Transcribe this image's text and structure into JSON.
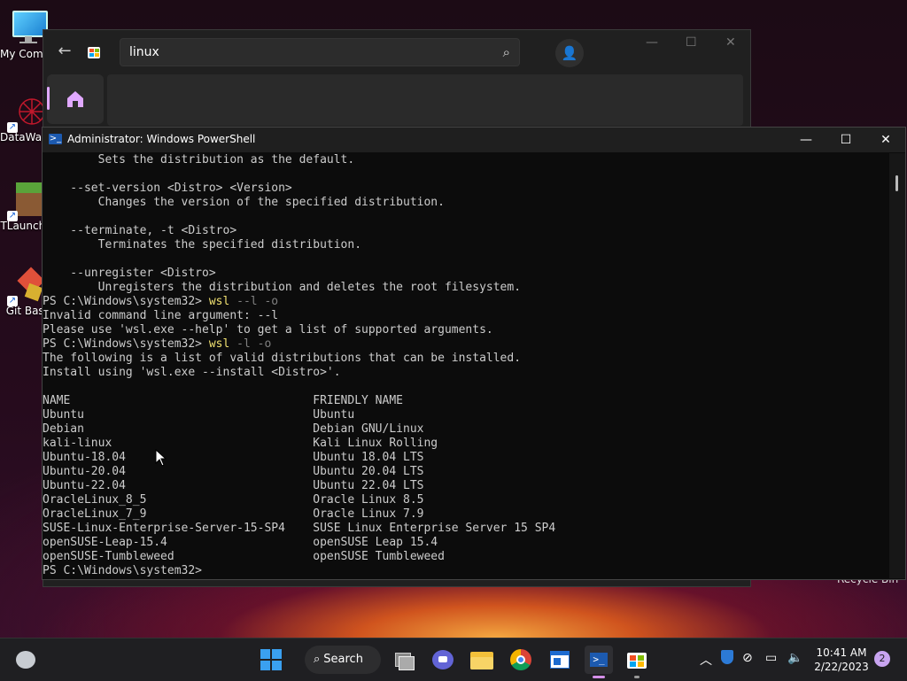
{
  "desktop": {
    "icons": [
      {
        "label": "My Computer",
        "icon": "monitor-icon"
      },
      {
        "label": "DataWarrior",
        "icon": "datawarrior-icon"
      },
      {
        "label": "TLauncher",
        "icon": "minecraft-block-icon"
      },
      {
        "label": "Git Bash",
        "icon": "git-bash-icon"
      }
    ],
    "recycle_bin_label": "Recycle Bin"
  },
  "store_window": {
    "search_value": "linux",
    "icons": {
      "back": "back-arrow-icon",
      "logo": "store-icon",
      "search": "search-icon",
      "account": "person-icon",
      "home": "home-icon"
    }
  },
  "powershell": {
    "title": "Administrator: Windows PowerShell",
    "lines": [
      {
        "segments": [
          {
            "t": "        Sets the distribution as the default.",
            "c": "plain"
          }
        ]
      },
      {
        "segments": [
          {
            "t": "",
            "c": "plain"
          }
        ]
      },
      {
        "segments": [
          {
            "t": "    --set-version <Distro> <Version>",
            "c": "plain"
          }
        ]
      },
      {
        "segments": [
          {
            "t": "        Changes the version of the specified distribution.",
            "c": "plain"
          }
        ]
      },
      {
        "segments": [
          {
            "t": "",
            "c": "plain"
          }
        ]
      },
      {
        "segments": [
          {
            "t": "    --terminate, -t <Distro>",
            "c": "plain"
          }
        ]
      },
      {
        "segments": [
          {
            "t": "        Terminates the specified distribution.",
            "c": "plain"
          }
        ]
      },
      {
        "segments": [
          {
            "t": "",
            "c": "plain"
          }
        ]
      },
      {
        "segments": [
          {
            "t": "    --unregister <Distro>",
            "c": "plain"
          }
        ]
      },
      {
        "segments": [
          {
            "t": "        Unregisters the distribution and deletes the root filesystem.",
            "c": "plain"
          }
        ]
      },
      {
        "segments": [
          {
            "t": "PS C:\\Windows\\system32> ",
            "c": "plain"
          },
          {
            "t": "wsl",
            "c": "cmd"
          },
          {
            "t": " --l -o",
            "c": "opt"
          }
        ]
      },
      {
        "segments": [
          {
            "t": "Invalid command line argument: --l",
            "c": "plain"
          }
        ]
      },
      {
        "segments": [
          {
            "t": "Please use 'wsl.exe --help' to get a list of supported arguments.",
            "c": "plain"
          }
        ]
      },
      {
        "segments": [
          {
            "t": "PS C:\\Windows\\system32> ",
            "c": "plain"
          },
          {
            "t": "wsl",
            "c": "cmd"
          },
          {
            "t": " -l -o",
            "c": "opt"
          }
        ]
      },
      {
        "segments": [
          {
            "t": "The following is a list of valid distributions that can be installed.",
            "c": "plain"
          }
        ]
      },
      {
        "segments": [
          {
            "t": "Install using 'wsl.exe --install <Distro>'.",
            "c": "plain"
          }
        ]
      },
      {
        "segments": [
          {
            "t": "",
            "c": "plain"
          }
        ]
      },
      {
        "segments": [
          {
            "t": "NAME                                   FRIENDLY NAME",
            "c": "plain"
          }
        ]
      },
      {
        "segments": [
          {
            "t": "Ubuntu                                 Ubuntu",
            "c": "plain"
          }
        ]
      },
      {
        "segments": [
          {
            "t": "Debian                                 Debian GNU/Linux",
            "c": "plain"
          }
        ]
      },
      {
        "segments": [
          {
            "t": "kali-linux                             Kali Linux Rolling",
            "c": "plain"
          }
        ]
      },
      {
        "segments": [
          {
            "t": "Ubuntu-18.04                           Ubuntu 18.04 LTS",
            "c": "plain"
          }
        ]
      },
      {
        "segments": [
          {
            "t": "Ubuntu-20.04                           Ubuntu 20.04 LTS",
            "c": "plain"
          }
        ]
      },
      {
        "segments": [
          {
            "t": "Ubuntu-22.04                           Ubuntu 22.04 LTS",
            "c": "plain"
          }
        ]
      },
      {
        "segments": [
          {
            "t": "OracleLinux_8_5                        Oracle Linux 8.5",
            "c": "plain"
          }
        ]
      },
      {
        "segments": [
          {
            "t": "OracleLinux_7_9                        Oracle Linux 7.9",
            "c": "plain"
          }
        ]
      },
      {
        "segments": [
          {
            "t": "SUSE-Linux-Enterprise-Server-15-SP4    SUSE Linux Enterprise Server 15 SP4",
            "c": "plain"
          }
        ]
      },
      {
        "segments": [
          {
            "t": "openSUSE-Leap-15.4                     openSUSE Leap 15.4",
            "c": "plain"
          }
        ]
      },
      {
        "segments": [
          {
            "t": "openSUSE-Tumbleweed                    openSUSE Tumbleweed",
            "c": "plain"
          }
        ]
      },
      {
        "segments": [
          {
            "t": "PS C:\\Windows\\system32>",
            "c": "plain"
          }
        ]
      }
    ]
  },
  "taskbar": {
    "search_label": "Search",
    "apps": [
      "task-view-icon",
      "teams-chat-icon",
      "file-explorer-icon",
      "chrome-icon",
      "notepad-icon",
      "powershell-icon",
      "store-icon"
    ],
    "tray": [
      "chevron-up-icon",
      "defender-icon",
      "network-off-icon",
      "display-icon",
      "volume-icon"
    ],
    "time": "10:41 AM",
    "date": "2/22/2023",
    "notification_count": "2"
  }
}
